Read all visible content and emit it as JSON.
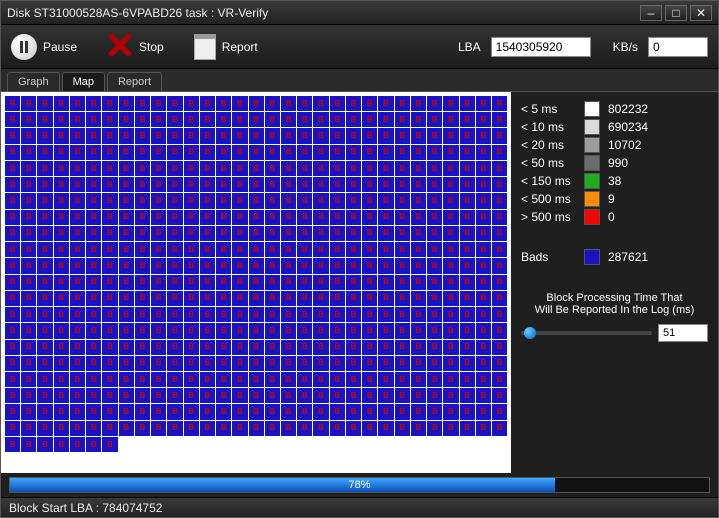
{
  "window": {
    "title": "Disk ST31000528AS-6VPABD26   task : VR-Verify"
  },
  "toolbar": {
    "pause_label": "Pause",
    "stop_label": "Stop",
    "report_label": "Report",
    "lba_label": "LBA",
    "lba_value": "1540305920",
    "kbs_label": "KB/s",
    "kbs_value": "0"
  },
  "tabs": {
    "graph": "Graph",
    "map": "Map",
    "report": "Report",
    "active": "map"
  },
  "map": {
    "cols": 31,
    "full_rows": 21,
    "last_row_count": 7,
    "glyph": "B"
  },
  "legend": [
    {
      "label": "< 5 ms",
      "color": "#ffffff",
      "count": "802232"
    },
    {
      "label": "< 10 ms",
      "color": "#d9d9d9",
      "count": "690234"
    },
    {
      "label": "< 20 ms",
      "color": "#9c9c9c",
      "count": "10702"
    },
    {
      "label": "< 50 ms",
      "color": "#6b6b6b",
      "count": "990"
    },
    {
      "label": "< 150 ms",
      "color": "#1faa1f",
      "count": "38"
    },
    {
      "label": "< 500 ms",
      "color": "#ff8c00",
      "count": "9"
    },
    {
      "label": "> 500 ms",
      "color": "#ff0000",
      "count": "0"
    }
  ],
  "bads": {
    "label": "Bads",
    "color": "#1814c4",
    "count": "287621"
  },
  "slider": {
    "caption_line1": "Block Processing Time That",
    "caption_line2": "Will Be Reported In the Log (ms)",
    "value": "51"
  },
  "progress": {
    "percent": 78,
    "text": "78%"
  },
  "status": {
    "text": "Block Start LBA : 784074752"
  }
}
